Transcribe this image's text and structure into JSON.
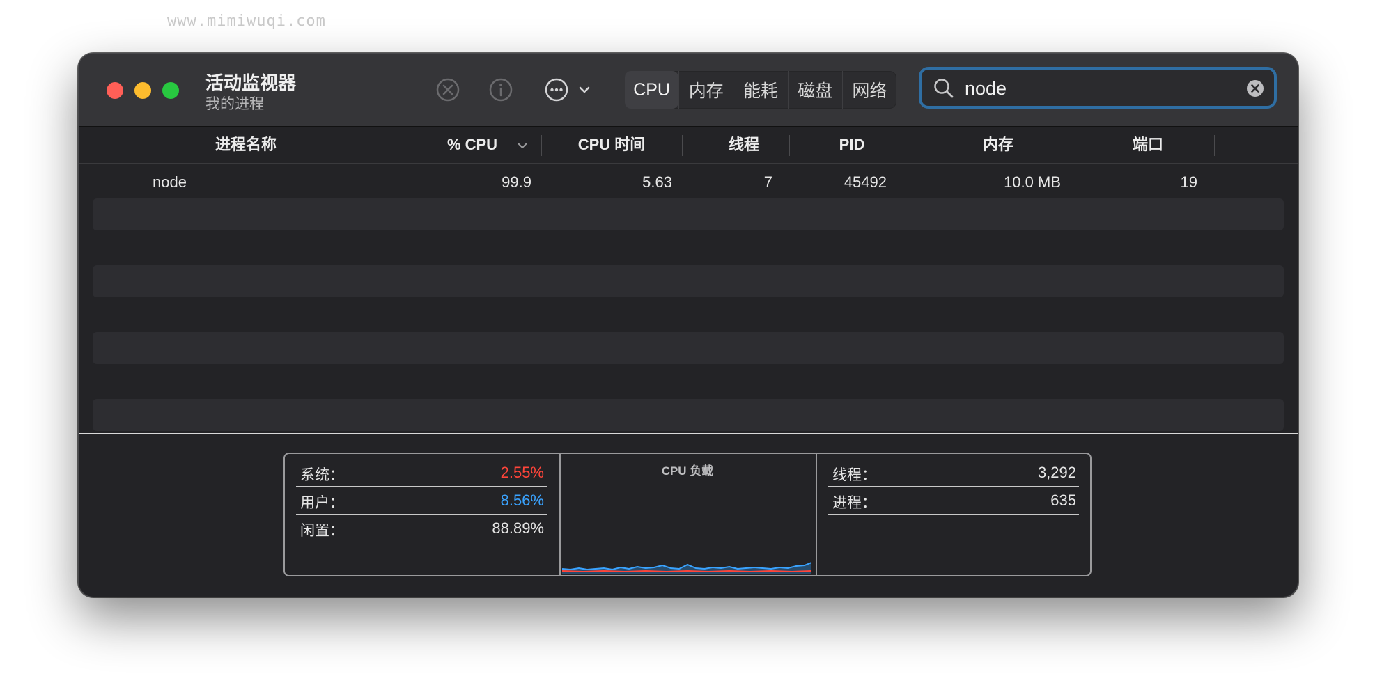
{
  "watermark": "www.mimiwuqi.com",
  "window": {
    "title": "活动监视器",
    "subtitle": "我的进程"
  },
  "toolbar": {
    "icons": [
      "stop-icon",
      "info-icon",
      "more-icon",
      "chevron-down-icon"
    ],
    "tabs": [
      {
        "label": "CPU",
        "active": true
      },
      {
        "label": "内存",
        "active": false
      },
      {
        "label": "能耗",
        "active": false
      },
      {
        "label": "磁盘",
        "active": false
      },
      {
        "label": "网络",
        "active": false
      }
    ],
    "search": {
      "value": "node",
      "icon": "search-icon",
      "clear_icon": "clear-icon"
    }
  },
  "table": {
    "columns": [
      "进程名称",
      "% CPU",
      "CPU 时间",
      "线程",
      "PID",
      "内存",
      "端口"
    ],
    "sort_column": "% CPU",
    "rows": [
      {
        "name": "node",
        "cpu": "99.9",
        "cpu_time": "5.63",
        "threads": "7",
        "pid": "45492",
        "memory": "10.0 MB",
        "ports": "19"
      }
    ]
  },
  "stats": {
    "left": [
      {
        "label": "系统：",
        "value": "2.55%",
        "color": "#ff453a"
      },
      {
        "label": "用户：",
        "value": "8.56%",
        "color": "#3aa3ff"
      },
      {
        "label": "闲置：",
        "value": "88.89%",
        "color": "#e6e6e6"
      }
    ],
    "cpu_load_title": "CPU 负载",
    "right": [
      {
        "label": "线程：",
        "value": "3,292"
      },
      {
        "label": "进程：",
        "value": "635"
      }
    ]
  },
  "colors": {
    "accent": "#2f6ea3",
    "system": "#ff453a",
    "user": "#3aa3ff"
  }
}
